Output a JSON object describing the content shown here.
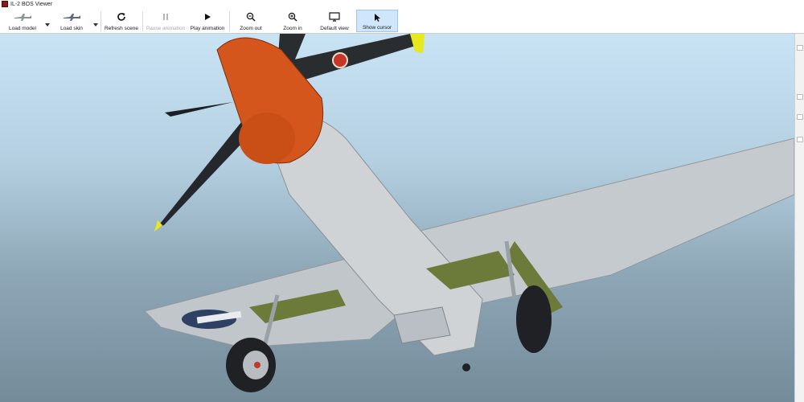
{
  "window": {
    "title": "IL-2 BOS Viewer"
  },
  "toolbar": {
    "load_model": "Load model",
    "load_skin": "Load skin",
    "refresh_scene": "Refresh scene",
    "pause_animation": "Pause animation",
    "play_animation": "Play animation",
    "zoom_out": "Zoom out",
    "zoom_in": "Zoom in",
    "default_view": "Default view",
    "show_cursor": "Show cursor"
  },
  "icons": {
    "app": "app-icon",
    "load_model": "aircraft-icon",
    "load_skin": "aircraft-skin-icon",
    "refresh": "refresh-icon",
    "pause": "pause-icon",
    "play": "play-icon",
    "zoom_out": "zoom-out-icon",
    "zoom_in": "zoom-in-icon",
    "default_view": "monitor-icon",
    "show_cursor": "cursor-icon"
  },
  "colors": {
    "accent_active": "#cfe6fb",
    "spinner": "#d4561c",
    "prop_tip": "#e8e81a",
    "fuselage": "#c7ccd1",
    "olive": "#6d7b3a"
  }
}
